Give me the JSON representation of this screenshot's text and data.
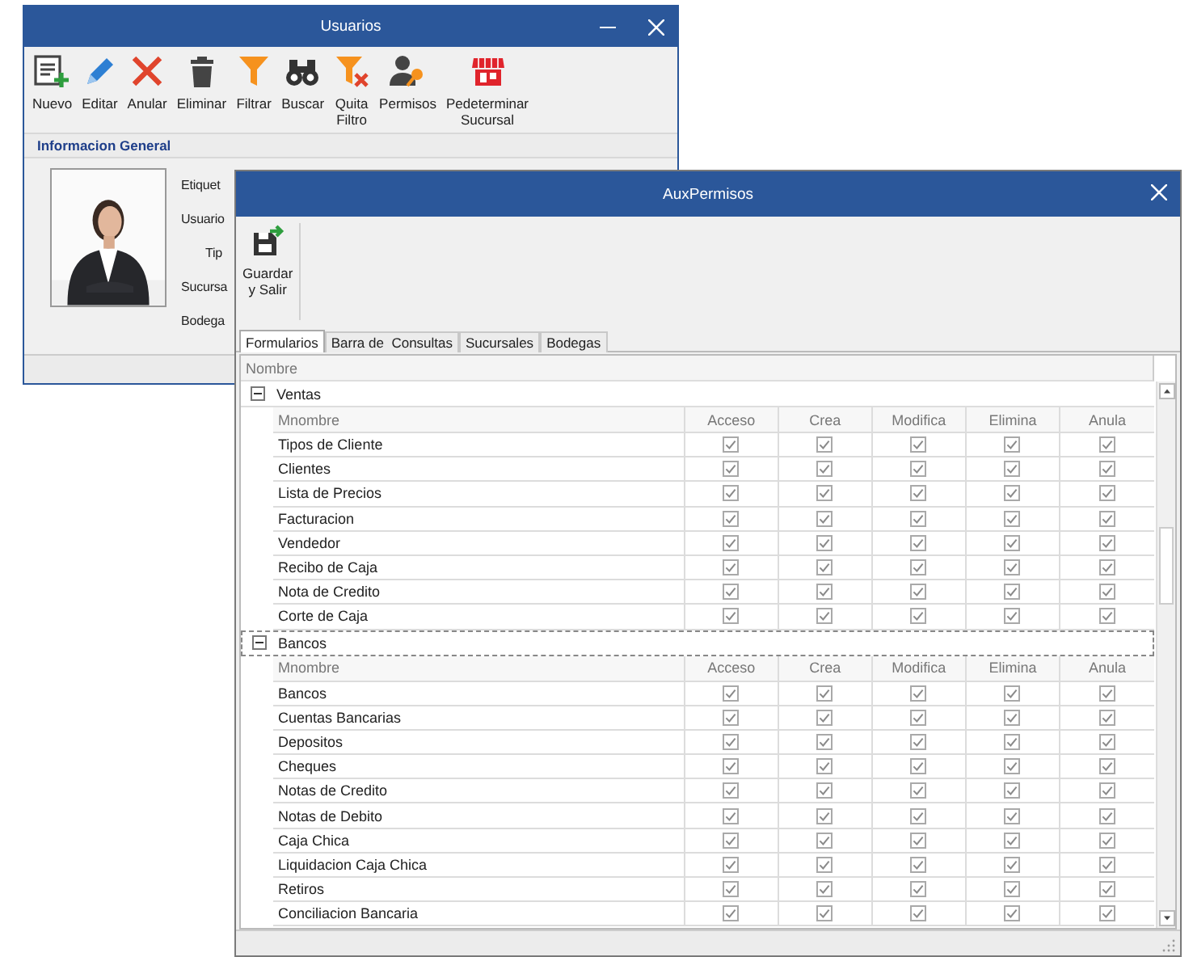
{
  "usuarios_window": {
    "title": "Usuarios",
    "toolbar": [
      {
        "label": "Nuevo"
      },
      {
        "label": "Editar"
      },
      {
        "label": "Anular"
      },
      {
        "label": "Eliminar"
      },
      {
        "label": "Filtrar"
      },
      {
        "label": "Buscar"
      },
      {
        "label": "Quita\nFiltro"
      },
      {
        "label": "Permisos"
      },
      {
        "label": "Pedeterminar\nSucursal"
      }
    ],
    "section_header": "Informacion General",
    "photo": {
      "kind": "picture"
    },
    "fields": [
      "Etiquet",
      "Usuario",
      "Tip",
      "Sucursa",
      "Bodega"
    ]
  },
  "permisos_window": {
    "title": "AuxPermisos",
    "toolbar": [
      {
        "label": "Guardar\ny Salir"
      }
    ],
    "tabs": [
      {
        "label": "Formularios",
        "selected": true
      },
      {
        "label": "Barra de  Consultas",
        "selected": false
      },
      {
        "label": "Sucursales",
        "selected": false
      },
      {
        "label": "Bodegas",
        "selected": false
      }
    ],
    "grid": {
      "column_header": "Nombre",
      "groups": [
        {
          "name": "Ventas",
          "expanded": true,
          "columns": [
            "Mnombre",
            "Acceso",
            "Crea",
            "Modifica",
            "Elimina",
            "Anula"
          ],
          "rows": [
            {
              "name": "Tipos de Cliente",
              "checks": [
                true,
                true,
                true,
                true,
                true
              ]
            },
            {
              "name": "Clientes",
              "checks": [
                true,
                true,
                true,
                true,
                true
              ]
            },
            {
              "name": "Lista de Precios",
              "checks": [
                true,
                true,
                true,
                true,
                true
              ]
            },
            {
              "name": "Facturacion",
              "checks": [
                true,
                true,
                true,
                true,
                true
              ]
            },
            {
              "name": "Vendedor",
              "checks": [
                true,
                true,
                true,
                true,
                true
              ]
            },
            {
              "name": "Recibo de Caja",
              "checks": [
                true,
                true,
                true,
                true,
                true
              ]
            },
            {
              "name": "Nota de Credito",
              "checks": [
                true,
                true,
                true,
                true,
                true
              ]
            },
            {
              "name": "Corte de Caja",
              "checks": [
                true,
                true,
                true,
                true,
                true
              ]
            }
          ]
        },
        {
          "name": "Bancos",
          "expanded": true,
          "columns": [
            "Mnombre",
            "Acceso",
            "Crea",
            "Modifica",
            "Elimina",
            "Anula"
          ],
          "rows": [
            {
              "name": "Bancos",
              "checks": [
                true,
                true,
                true,
                true,
                true
              ]
            },
            {
              "name": "Cuentas Bancarias",
              "checks": [
                true,
                true,
                true,
                true,
                true
              ]
            },
            {
              "name": "Depositos",
              "checks": [
                true,
                true,
                true,
                true,
                true
              ]
            },
            {
              "name": "Cheques",
              "checks": [
                true,
                true,
                true,
                true,
                true
              ]
            },
            {
              "name": "Notas de Credito",
              "checks": [
                true,
                true,
                true,
                true,
                true
              ]
            },
            {
              "name": "Notas de Debito",
              "checks": [
                true,
                true,
                true,
                true,
                true
              ]
            },
            {
              "name": "Caja Chica",
              "checks": [
                true,
                true,
                true,
                true,
                true
              ]
            },
            {
              "name": "Liquidacion Caja Chica",
              "checks": [
                true,
                true,
                true,
                true,
                true
              ]
            },
            {
              "name": "Retiros",
              "checks": [
                true,
                true,
                true,
                true,
                true
              ]
            },
            {
              "name": "Conciliacion Bancaria",
              "checks": [
                true,
                true,
                true,
                true,
                true
              ]
            }
          ]
        }
      ]
    }
  }
}
